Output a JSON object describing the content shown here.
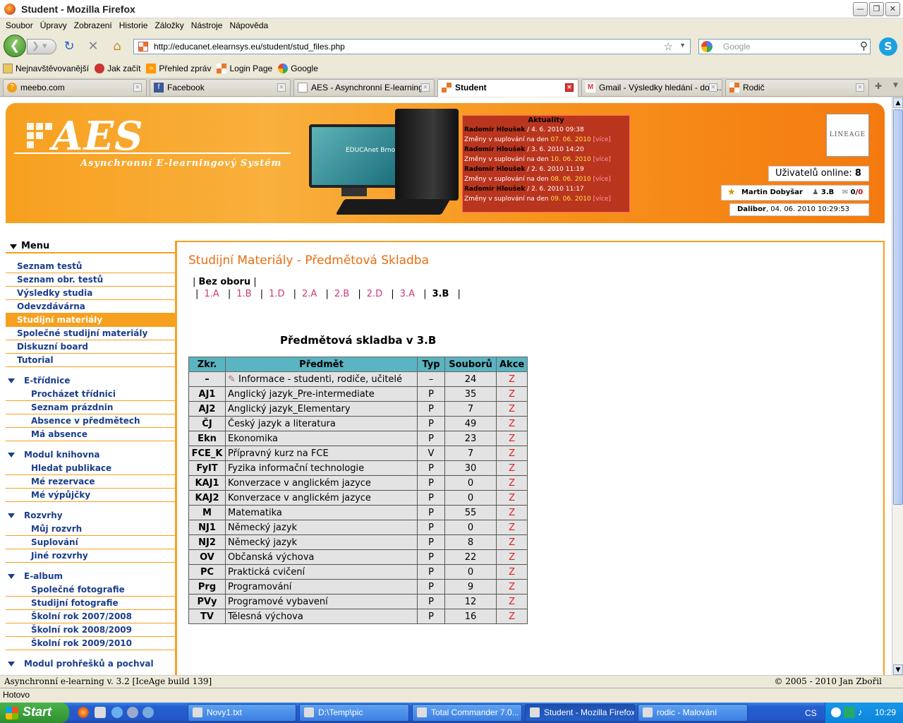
{
  "window": {
    "title": "Student - Mozilla Firefox"
  },
  "menubar": [
    "Soubor",
    "Úpravy",
    "Zobrazení",
    "Historie",
    "Záložky",
    "Nástroje",
    "Nápověda"
  ],
  "navbar": {
    "url": "http://educanet.elearnsys.eu/student/stud_files.php",
    "search_placeholder": "Google"
  },
  "bookmarks": [
    "Nejnavštěvovanější",
    "Jak začít",
    "Přehled zpráv",
    "Login Page",
    "Google"
  ],
  "tabs": [
    "meebo.com",
    "Facebook",
    "AES - Asynchronní E-learning...",
    "Student",
    "Gmail - Výsledky hledání - dob...",
    "Rodič"
  ],
  "header": {
    "logo": "AES",
    "subtitle": "Asynchronní E-learningový Systém",
    "monitor_text": "EDUCAnet Brno",
    "news_title": "Aktuality",
    "news": [
      {
        "author": "Radomír Hloušek",
        "date": " / 4. 6. 2010 09:38",
        "text": "Změny v suplování na den ",
        "day": "07. 06. 2010",
        "more": "[více]"
      },
      {
        "author": "Radomír Hloušek",
        "date": " / 3. 6. 2010 14:20",
        "text": "Změny v suplování na den ",
        "day": "10. 06. 2010",
        "more": "[více]"
      },
      {
        "author": "Radomír Hloušek",
        "date": " / 2. 6. 2010 11:19",
        "text": "Změny v suplování na den ",
        "day": "08. 06. 2010",
        "more": "[více]"
      },
      {
        "author": "Radomír Hloušek",
        "date": " / 2. 6. 2010 11:17",
        "text": "Změny v suplování na den ",
        "day": "09. 06. 2010",
        "more": "[více]"
      }
    ],
    "lineage": "LINEAGE",
    "online_label": "Uživatelů online: ",
    "online_count": "8",
    "user_name": "Martin Dobyšar",
    "user_class": "3.B",
    "messages_a": "0",
    "messages_b": "0",
    "login_user": "Dalibor",
    "login_time": ", 04. 06. 2010 10:29:53"
  },
  "menu": {
    "title": "Menu",
    "items": [
      "Seznam testů",
      "Seznam obr. testů",
      "Výsledky studia",
      "Odevzdávárna",
      "Studijní materiály",
      "Společné studijní materiály",
      "Diskuzní board",
      "Tutorial"
    ],
    "sections": [
      {
        "title": "E-třídnice",
        "items": [
          "Procházet třídnici",
          "Seznam prázdnin",
          "Absence v předmětech",
          "Má absence"
        ]
      },
      {
        "title": "Modul knihovna",
        "items": [
          "Hledat publikace",
          "Mé rezervace",
          "Mé výpůjčky"
        ]
      },
      {
        "title": "Rozvrhy",
        "items": [
          "Můj rozvrh",
          "Suplování",
          "Jiné rozvrhy"
        ]
      },
      {
        "title": "E-album",
        "items": [
          "Společné fotografie",
          "Studijní fotografie",
          "Školní rok 2007/2008",
          "Školní rok 2008/2009",
          "Školní rok 2009/2010"
        ]
      },
      {
        "title": "Modul prohřešků a pochval",
        "items": []
      }
    ]
  },
  "main": {
    "title": "Studijní Materiály - Předmětová Skladba",
    "field": "Bez oboru",
    "classes": [
      "1.A",
      "1.B",
      "1.D",
      "2.A",
      "2.B",
      "2.D",
      "3.A",
      "3.B"
    ],
    "selected_class": "3.B",
    "table_title": "Předmětová skladba v 3.B",
    "columns": [
      "Zkr.",
      "Předmět",
      "Typ",
      "Souborů",
      "Akce"
    ],
    "rows": [
      [
        "–",
        "Informace - studenti, rodiče, učitelé",
        "–",
        "24",
        "Z"
      ],
      [
        "AJ1",
        "Anglický jazyk_Pre-intermediate",
        "P",
        "35",
        "Z"
      ],
      [
        "AJ2",
        "Anglický jazyk_Elementary",
        "P",
        "7",
        "Z"
      ],
      [
        "ČJ",
        "Český jazyk a literatura",
        "P",
        "49",
        "Z"
      ],
      [
        "Ekn",
        "Ekonomika",
        "P",
        "23",
        "Z"
      ],
      [
        "FCE_K",
        "Přípravný kurz na FCE",
        "V",
        "7",
        "Z"
      ],
      [
        "FyIT",
        "Fyzika informační technologie",
        "P",
        "30",
        "Z"
      ],
      [
        "KAJ1",
        "Konverzace v anglickém jazyce",
        "P",
        "0",
        "Z"
      ],
      [
        "KAJ2",
        "Konverzace v anglickém jazyce",
        "P",
        "0",
        "Z"
      ],
      [
        "M",
        "Matematika",
        "P",
        "55",
        "Z"
      ],
      [
        "NJ1",
        "Německý jazyk",
        "P",
        "0",
        "Z"
      ],
      [
        "NJ2",
        "Německý jazyk",
        "P",
        "8",
        "Z"
      ],
      [
        "OV",
        "Občanská výchova",
        "P",
        "22",
        "Z"
      ],
      [
        "PC",
        "Praktická cvičení",
        "P",
        "0",
        "Z"
      ],
      [
        "Prg",
        "Programování",
        "P",
        "9",
        "Z"
      ],
      [
        "PVy",
        "Programové vybavení",
        "P",
        "12",
        "Z"
      ],
      [
        "TV",
        "Tělesná výchova",
        "P",
        "16",
        "Z"
      ]
    ]
  },
  "page_status": {
    "left": "Asynchronní e-learning v. 3.2 [IceAge build 139]",
    "right": "© 2005 - 2010 Jan Zbořil"
  },
  "ff_status": "Hotovo",
  "taskbar": {
    "start": "Start",
    "buttons": [
      "Novy1.txt",
      "D:\\Temp\\pic",
      "Total Commander 7.0...",
      "Student - Mozilla Firefox",
      "rodic - Malování"
    ],
    "lang": "CS",
    "clock": "10:29"
  },
  "colors": {
    "accent": "#f7a01f",
    "title": "#e66e12",
    "menu_text": "#1b3e8c",
    "table_header": "#5ab4c2",
    "news_bg": "#b9351e"
  }
}
